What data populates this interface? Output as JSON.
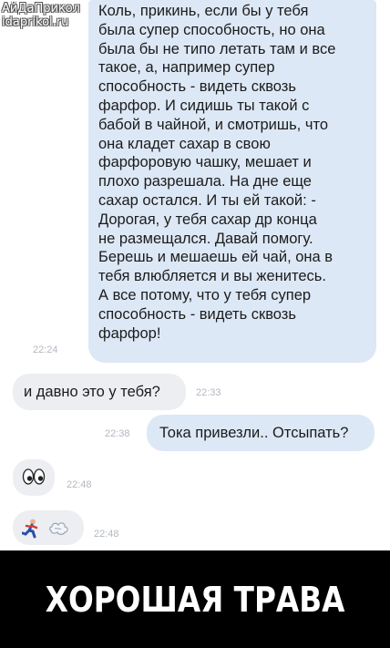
{
  "watermark": {
    "line1": "АйДаПрикол",
    "line2": "idaprikol.ru"
  },
  "messages": [
    {
      "direction": "outgoing",
      "text": "Коль, прикинь, если бы у тебя\nбыла супер способность, но она\nбыла бы не типо летать там и все\nтакое, а, например супер\nспособность - видеть сквозь\nфарфор. И сидишь ты такой с\nбабой в чайной, и смотришь, что\nона кладет сахар в свою\nфарфоровую чашку, мешает и\nплохо разрешала. На дне еще\nсахар остался. И ты ей такой: -\nДорогая, у тебя сахар др конца\nне размещался. Давай помогу.\nБерешь и мешаешь ей чай, она в\nтебя влюбляется и вы женитесь.\nА все потому, что у тебя супер\nспособность - видеть сквозь\nфарфор!",
      "time": "22:24"
    },
    {
      "direction": "incoming",
      "text": "и давно это у тебя?",
      "time": "22:33"
    },
    {
      "direction": "outgoing",
      "text": "Тока привезли.. Отсыпать?",
      "time": "22:38"
    },
    {
      "direction": "incoming",
      "emoji": [
        "eyes-icon"
      ],
      "time": "22:48"
    },
    {
      "direction": "incoming",
      "emoji": [
        "runner-icon",
        "dash-icon"
      ],
      "time": "22:48"
    }
  ],
  "colors": {
    "outgoing_bubble": "#dde8f6",
    "incoming_bubble": "#eceef2",
    "time": "#b3b8c0",
    "banner": "#000000"
  },
  "caption": "ХОРОШАЯ ТРАВА"
}
